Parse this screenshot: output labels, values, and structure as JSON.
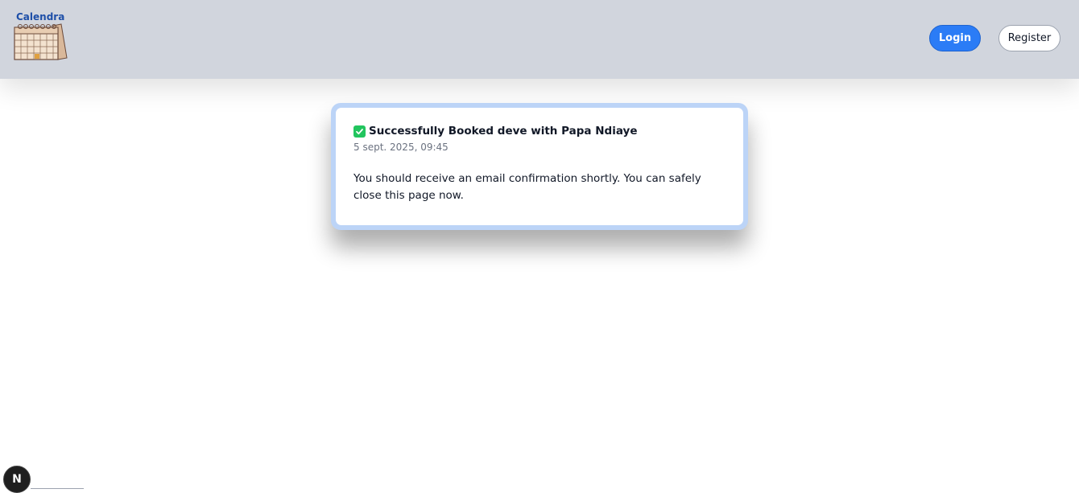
{
  "header": {
    "logo_text": "Calendra",
    "login_label": "Login",
    "register_label": "Register"
  },
  "booking": {
    "title": "Successfully Booked deve with Papa Ndiaye",
    "datetime": "5 sept. 2025, 09:45",
    "message": "You should receive an email confirmation shortly. You can safely close this page now."
  },
  "dev_badge": {
    "label": "N",
    "icon": "nextjs-icon"
  },
  "colors": {
    "header_bg": "#d1d5dd",
    "login_bg": "#2b7cf6",
    "card_frame": "#bcd4f7",
    "check_green": "#22c55e"
  }
}
